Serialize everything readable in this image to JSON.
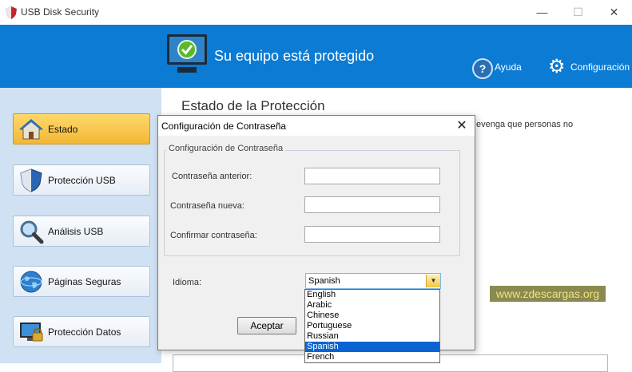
{
  "window": {
    "title": "USB Disk Security",
    "minimize_glyph": "—",
    "maximize_glyph": "☐",
    "close_glyph": "✕"
  },
  "header": {
    "status_text": "Su equipo está protegido",
    "help_label": "Ayuda",
    "help_glyph": "?",
    "config_label": "Configuración",
    "config_glyph": "⚙",
    "accent_color": "#0b7bd3"
  },
  "sidebar": {
    "items": [
      {
        "label": "Estado",
        "icon": "home-icon",
        "active": true
      },
      {
        "label": "Protección USB",
        "icon": "shield-icon",
        "active": false
      },
      {
        "label": "Análisis USB",
        "icon": "magnifier-icon",
        "active": false
      },
      {
        "label": "Páginas Seguras",
        "icon": "globe-icon",
        "active": false
      },
      {
        "label": "Protección Datos",
        "icon": "monitor-lock-icon",
        "active": false
      }
    ]
  },
  "main": {
    "title": "Estado de la Protección",
    "partial_text": "evenga que personas no",
    "watermark": "www.zdescargas.org"
  },
  "dialog": {
    "title": "Configuración de Contraseña",
    "close_glyph": "✕",
    "group_label": "Configuración de Contraseña",
    "old_password_label": "Contraseña anterior:",
    "new_password_label": "Contraseña nueva:",
    "confirm_password_label": "Confirmar contraseña:",
    "old_password_value": "",
    "new_password_value": "",
    "confirm_password_value": "",
    "language_label": "Idioma:",
    "language_selected": "Spanish",
    "language_arrow": "▼",
    "language_options": [
      "English",
      "Arabic",
      "Chinese",
      "Portuguese",
      "Russian",
      "Spanish",
      "French"
    ],
    "ok_label": "Aceptar"
  }
}
